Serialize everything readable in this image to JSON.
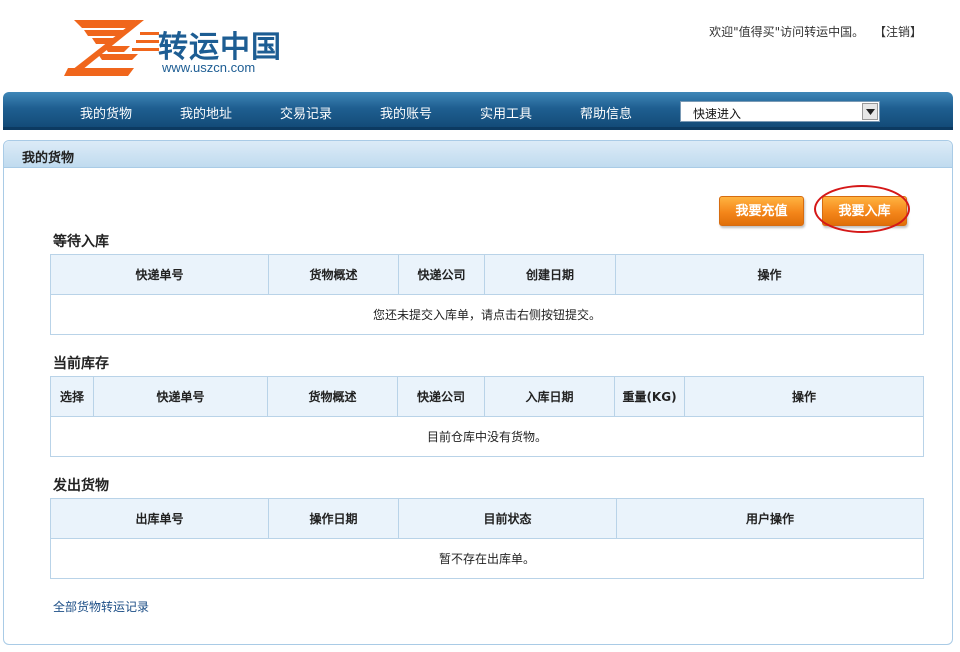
{
  "brand": {
    "name_cn": "转运中国",
    "url": "www.uszcn.com",
    "colors": {
      "logo_orange": "#f0661c",
      "logo_blue": "#1d5d93"
    }
  },
  "header": {
    "welcome": "欢迎\"值得买\"访问转运中国。",
    "logout": "【注销】"
  },
  "nav": {
    "items": [
      "我的货物",
      "我的地址",
      "交易记录",
      "我的账号",
      "实用工具",
      "帮助信息"
    ],
    "quick_entry": "快速进入",
    "colors": {
      "bar": "#1f5f91"
    }
  },
  "panel": {
    "title": "我的货物",
    "buttons": {
      "recharge": "我要充值",
      "inbound": "我要入库"
    },
    "accent": "#f4861a",
    "highlight_color": "#d51818"
  },
  "pending": {
    "title": "等待入库",
    "columns": [
      "快递单号",
      "货物概述",
      "快递公司",
      "创建日期",
      "操作"
    ],
    "empty": "您还未提交入库单，请点击右侧按钮提交。"
  },
  "inventory": {
    "title": "当前库存",
    "columns": [
      "选择",
      "快递单号",
      "货物概述",
      "快递公司",
      "入库日期",
      "重量(KG)",
      "操作"
    ],
    "empty": "目前仓库中没有货物。"
  },
  "shipped": {
    "title": "发出货物",
    "columns": [
      "出库单号",
      "操作日期",
      "目前状态",
      "用户操作"
    ],
    "empty": "暂不存在出库单。"
  },
  "footer_link": "全部货物转运记录"
}
